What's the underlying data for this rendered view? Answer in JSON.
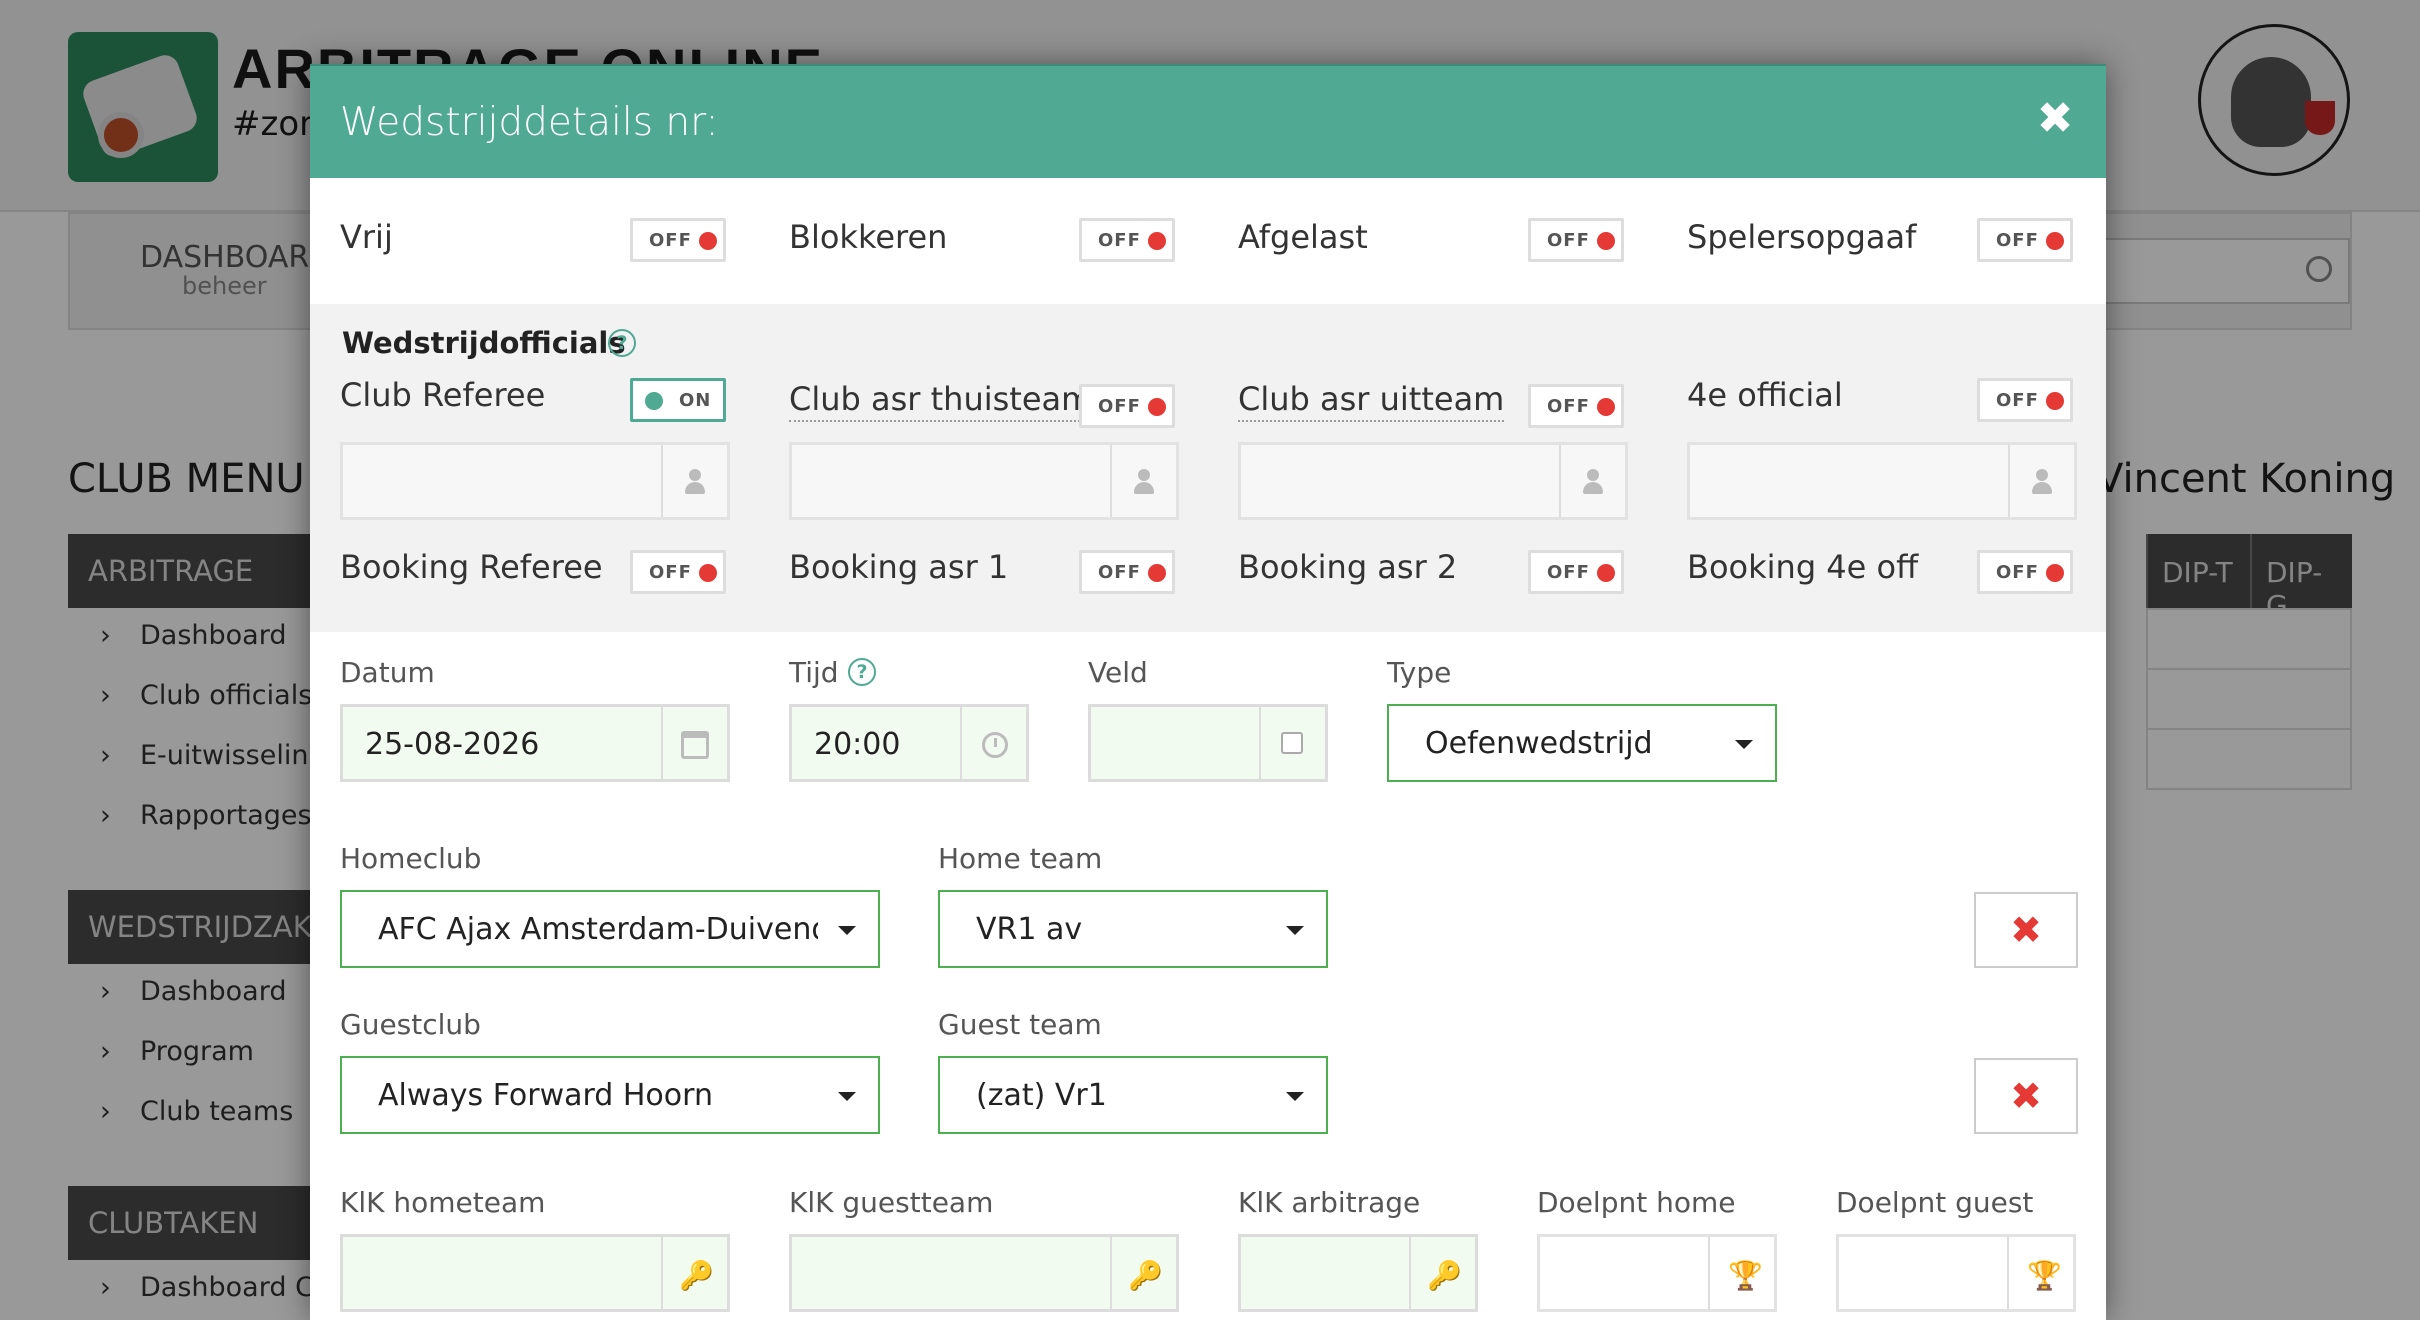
{
  "background": {
    "brand_title": "ARBITRAGE ONLINE",
    "brand_subtitle": "#zorg",
    "nav_dashboard": "DASHBOARD",
    "nav_dashboard_sub": "beheer",
    "club_menu_title": "CLUB MENU",
    "user_name": "Vincent Koning",
    "table_headers": [
      "DIP-T",
      "DIP-G"
    ],
    "menu_sections": [
      {
        "title": "ARBITRAGE",
        "items": [
          "Dashboard",
          "Club officials",
          "E-uitwisseling",
          "Rapportages"
        ]
      },
      {
        "title": "WEDSTRIJDZAKEN",
        "items": [
          "Dashboard",
          "Program",
          "Club teams"
        ]
      },
      {
        "title": "CLUBTAKEN",
        "items": [
          "Dashboard Cl"
        ]
      }
    ]
  },
  "modal": {
    "title": "Wedstrijddetails nr:",
    "close_label": "✖",
    "top_switches": [
      {
        "label": "Vrij",
        "state": "OFF"
      },
      {
        "label": "Blokkeren",
        "state": "OFF"
      },
      {
        "label": "Afgelast",
        "state": "OFF"
      },
      {
        "label": "Spelersopgaaf",
        "state": "OFF"
      }
    ],
    "officials_title": "Wedstrijdofficials",
    "help_glyph": "?",
    "officials": [
      {
        "label": "Club Referee",
        "state": "ON"
      },
      {
        "label": "Club asr thuisteam",
        "state": "OFF"
      },
      {
        "label": "Club asr uitteam",
        "state": "OFF"
      },
      {
        "label": "4e official",
        "state": "OFF"
      }
    ],
    "bookings": [
      {
        "label": "Booking Referee",
        "state": "OFF"
      },
      {
        "label": "Booking asr 1",
        "state": "OFF"
      },
      {
        "label": "Booking asr 2",
        "state": "OFF"
      },
      {
        "label": "Booking 4e off",
        "state": "OFF"
      }
    ],
    "datum_label": "Datum",
    "datum_value": "25-08-2026",
    "tijd_label": "Tijd",
    "tijd_value": "20:00",
    "veld_label": "Veld",
    "type_label": "Type",
    "type_value": "Oefenwedstrijd",
    "homeclub_label": "Homeclub",
    "homeclub_value": "AFC Ajax Amsterdam-Duivendrec",
    "hometeam_label": "Home team",
    "hometeam_value": "VR1 av",
    "guestclub_label": "Guestclub",
    "guestclub_value": "Always Forward Hoorn",
    "guestteam_label": "Guest team",
    "guestteam_value": "(zat) Vr1",
    "remove_glyph": "✖",
    "klk_hometeam_label": "KlK hometeam",
    "klk_guestteam_label": "KlK guestteam",
    "klk_arbitrage_label": "KlK arbitrage",
    "doelpnt_home_label": "Doelpnt home",
    "doelpnt_guest_label": "Doelpnt guest",
    "icons": {
      "key": "🔑",
      "trophy": "🏆"
    }
  },
  "colors": {
    "accent": "#4fa993",
    "off_dot": "#e53935",
    "select_border": "#4caf50"
  }
}
